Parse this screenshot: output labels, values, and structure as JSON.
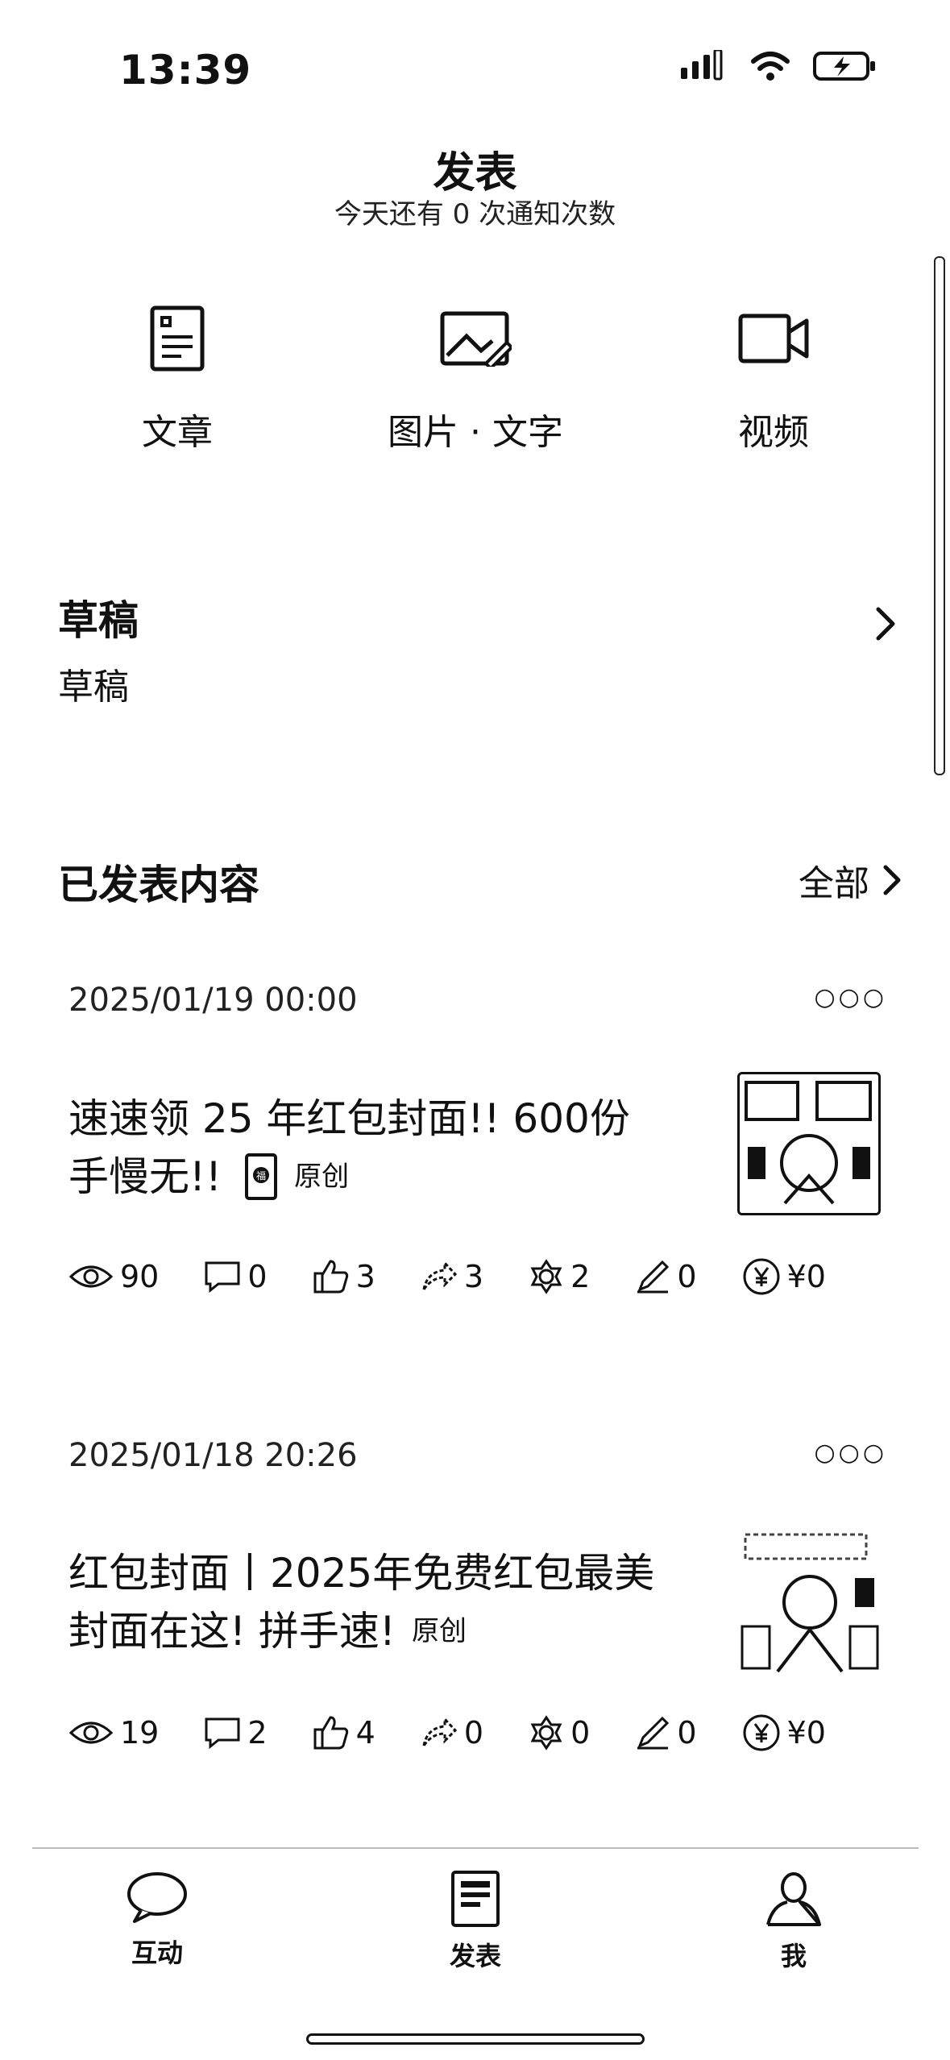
{
  "status_bar": {
    "time": "13:39"
  },
  "header": {
    "title": "发表",
    "subtitle": "今天还有 0 次通知次数"
  },
  "publish_options": [
    {
      "label": "文章",
      "icon": "article-icon"
    },
    {
      "label": "图片 · 文字",
      "icon": "image-text-icon"
    },
    {
      "label": "视频",
      "icon": "video-icon"
    }
  ],
  "drafts": {
    "title": "草稿",
    "subtitle": "草稿"
  },
  "published": {
    "title": "已发表内容",
    "all_label": "全部",
    "items": [
      {
        "date": "2025/01/19 00:00",
        "title_line1": "速速领 25 年红包封面!! 600份",
        "title_line2": "手慢无!!",
        "original": "原创",
        "stats": {
          "views": "90",
          "comments": "0",
          "likes": "3",
          "shares": "3",
          "favorites": "2",
          "edits": "0",
          "earnings": "¥0"
        }
      },
      {
        "date": "2025/01/18 20:26",
        "title_line1": "红包封面丨2025年免费红包最美",
        "title_line2": "封面在这! 拼手速!",
        "original": "原创",
        "stats": {
          "views": "19",
          "comments": "2",
          "likes": "4",
          "shares": "0",
          "favorites": "0",
          "edits": "0",
          "earnings": "¥0"
        }
      }
    ]
  },
  "tab_bar": [
    {
      "label": "互动",
      "icon": "chat-bubble-icon"
    },
    {
      "label": "发表",
      "icon": "publish-doc-icon"
    },
    {
      "label": "我",
      "icon": "person-icon"
    }
  ]
}
